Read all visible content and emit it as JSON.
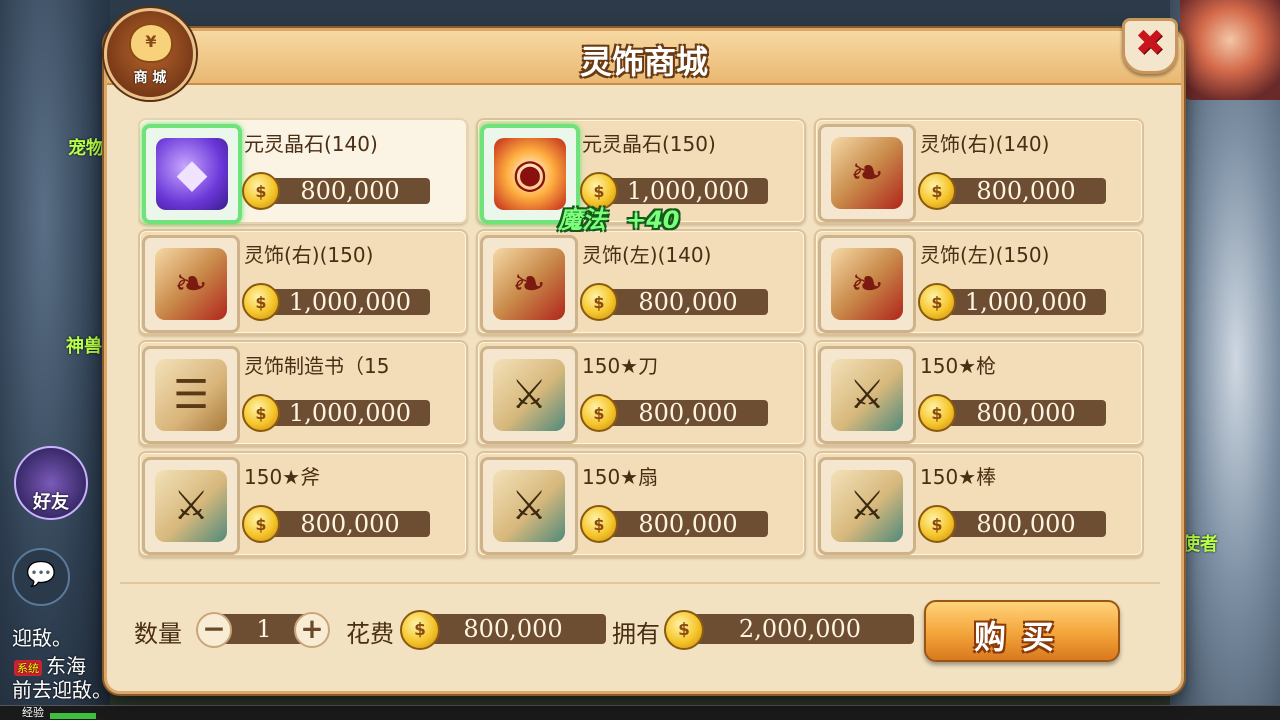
{
  "shop": {
    "title": "灵饰商城",
    "badge_label": "商 城",
    "badge_symbol": "¥",
    "close_symbol": "✖"
  },
  "items": [
    {
      "name": "元灵晶石(140)",
      "price": "800,000",
      "icon": "crystal-icon",
      "selected": true
    },
    {
      "name": "元灵晶石(150)",
      "price": "1,000,000",
      "icon": "drum-icon",
      "bonus_label": "魔法",
      "bonus_value": "+40"
    },
    {
      "name": "灵饰(右)(140)",
      "price": "800,000",
      "icon": "book-icon"
    },
    {
      "name": "灵饰(右)(150)",
      "price": "1,000,000",
      "icon": "book-icon"
    },
    {
      "name": "灵饰(左)(140)",
      "price": "800,000",
      "icon": "book-icon"
    },
    {
      "name": "灵饰(左)(150)",
      "price": "1,000,000",
      "icon": "book-icon"
    },
    {
      "name": "灵饰制造书（15",
      "price": "1,000,000",
      "icon": "scroll-icon"
    },
    {
      "name": "150★刀",
      "price": "800,000",
      "icon": "blueprint-icon"
    },
    {
      "name": "150★枪",
      "price": "800,000",
      "icon": "blueprint-icon"
    },
    {
      "name": "150★斧",
      "price": "800,000",
      "icon": "blueprint-icon"
    },
    {
      "name": "150★扇",
      "price": "800,000",
      "icon": "blueprint-icon"
    },
    {
      "name": "150★棒",
      "price": "800,000",
      "icon": "blueprint-icon"
    }
  ],
  "footer": {
    "qty_label": "数量",
    "qty_value": "1",
    "minus": "−",
    "plus": "+",
    "cost_label": "花费",
    "cost_value": "800,000",
    "own_label": "拥有",
    "own_value": "2,000,000",
    "buy_label": "购买"
  },
  "background": {
    "left_texts": [
      "宠物",
      "神兽"
    ],
    "friends_label": "好友",
    "chat_lines": [
      "迎敌。",
      "东海",
      "前去迎敌。"
    ],
    "system_tag": "系统",
    "exp_label": "经验",
    "right_texts": [
      "使者"
    ]
  }
}
